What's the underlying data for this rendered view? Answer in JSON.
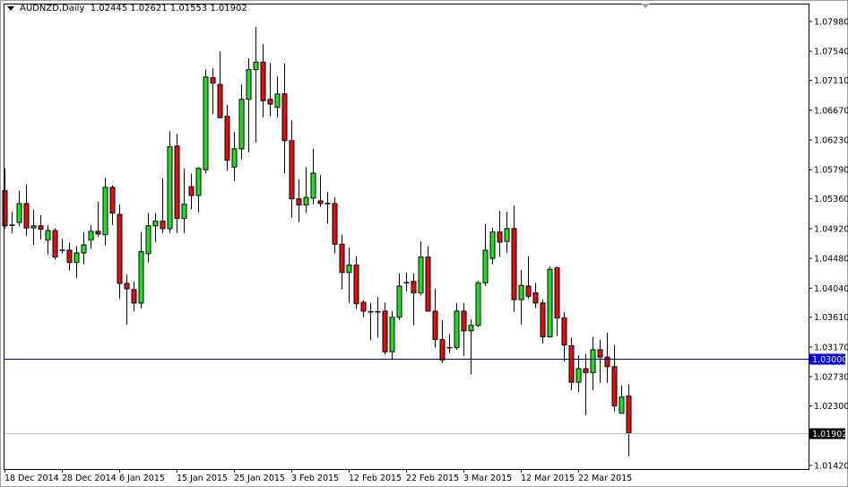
{
  "header": {
    "symbol": "AUDNZD,Daily",
    "ohlc": "1.02445 1.02621 1.01553 1.01902"
  },
  "colors": {
    "bull": "#22dd22",
    "bear": "#dd1111",
    "level_line": "#000080",
    "level_badge": "#0000ee",
    "price_line": "#c0c0c0",
    "price_badge": "#000000"
  },
  "chart_data": {
    "type": "candlestick",
    "title": "AUDNZD,Daily",
    "ylim": [
      1.0134,
      1.0825
    ],
    "y_ticks": [
      "1.07980",
      "1.07540",
      "1.07110",
      "1.06670",
      "1.06230",
      "1.05790",
      "1.05360",
      "1.04920",
      "1.04480",
      "1.04040",
      "1.03610",
      "1.03170",
      "1.02730",
      "1.02300",
      "1.01420"
    ],
    "x_labels": [
      {
        "index": 0,
        "label": "18 Dec 2014"
      },
      {
        "index": 8,
        "label": "28 Dec 2014"
      },
      {
        "index": 16,
        "label": "6 Jan 2015"
      },
      {
        "index": 24,
        "label": "15 Jan 2015"
      },
      {
        "index": 32,
        "label": "25 Jan 2015"
      },
      {
        "index": 40,
        "label": "3 Feb 2015"
      },
      {
        "index": 48,
        "label": "12 Feb 2015"
      },
      {
        "index": 56,
        "label": "22 Feb 2015"
      },
      {
        "index": 64,
        "label": "3 Mar 2015"
      },
      {
        "index": 72,
        "label": "12 Mar 2015"
      },
      {
        "index": 80,
        "label": "22 Mar 2015"
      }
    ],
    "horizontal_level": {
      "value": 1.03,
      "label": "1.03000"
    },
    "current_price": {
      "value": 1.01902,
      "label": "1.01902"
    },
    "candles": [
      [
        1.0548,
        1.0581,
        1.0492,
        1.0496
      ],
      [
        1.0497,
        1.0517,
        1.0485,
        1.0496
      ],
      [
        1.0501,
        1.0548,
        1.0495,
        1.0529
      ],
      [
        1.0529,
        1.0557,
        1.0481,
        1.0493
      ],
      [
        1.0493,
        1.052,
        1.0468,
        1.0496
      ],
      [
        1.0496,
        1.0512,
        1.0476,
        1.0491
      ],
      [
        1.0475,
        1.0497,
        1.0454,
        1.0489
      ],
      [
        1.0489,
        1.0492,
        1.0446,
        1.045
      ],
      [
        1.046,
        1.0477,
        1.0455,
        1.0459
      ],
      [
        1.046,
        1.0471,
        1.043,
        1.0442
      ],
      [
        1.0442,
        1.0466,
        1.0419,
        1.0456
      ],
      [
        1.0456,
        1.0487,
        1.0439,
        1.0468
      ],
      [
        1.0475,
        1.0497,
        1.0462,
        1.0488
      ],
      [
        1.0488,
        1.0532,
        1.048,
        1.0484
      ],
      [
        1.0483,
        1.0567,
        1.0467,
        1.0553
      ],
      [
        1.0553,
        1.0556,
        1.0497,
        1.0515
      ],
      [
        1.0513,
        1.0528,
        1.0388,
        1.0411
      ],
      [
        1.0411,
        1.0424,
        1.035,
        1.0403
      ],
      [
        1.0402,
        1.0414,
        1.037,
        1.0382
      ],
      [
        1.0382,
        1.0487,
        1.0374,
        1.0458
      ],
      [
        1.0455,
        1.0515,
        1.0442,
        1.0496
      ],
      [
        1.0496,
        1.0515,
        1.0472,
        1.0503
      ],
      [
        1.0503,
        1.0566,
        1.0485,
        1.0492
      ],
      [
        1.0492,
        1.0636,
        1.0485,
        1.0613
      ],
      [
        1.0614,
        1.0632,
        1.0485,
        1.0507
      ],
      [
        1.0507,
        1.0581,
        1.0485,
        1.0528
      ],
      [
        1.0554,
        1.0573,
        1.0521,
        1.0541
      ],
      [
        1.0541,
        1.0583,
        1.0516,
        1.0581
      ],
      [
        1.0579,
        1.0727,
        1.0574,
        1.0716
      ],
      [
        1.0715,
        1.0729,
        1.0661,
        1.0707
      ],
      [
        1.0705,
        1.0754,
        1.0655,
        1.0656
      ],
      [
        1.0658,
        1.0675,
        1.0577,
        1.0593
      ],
      [
        1.0583,
        1.0635,
        1.0562,
        1.061
      ],
      [
        1.061,
        1.0705,
        1.0595,
        1.0683
      ],
      [
        1.0683,
        1.0744,
        1.0605,
        1.0727
      ],
      [
        1.0727,
        1.079,
        1.0619,
        1.0738
      ],
      [
        1.0738,
        1.0765,
        1.0656,
        1.0681
      ],
      [
        1.0683,
        1.0737,
        1.0658,
        1.0676
      ],
      [
        1.0671,
        1.0717,
        1.0656,
        1.0691
      ],
      [
        1.0691,
        1.0736,
        1.0574,
        1.0622
      ],
      [
        1.0622,
        1.0652,
        1.0508,
        1.0536
      ],
      [
        1.0536,
        1.0565,
        1.0501,
        1.0527
      ],
      [
        1.0527,
        1.0583,
        1.0515,
        1.0538
      ],
      [
        1.0537,
        1.061,
        1.0528,
        1.0574
      ],
      [
        1.0533,
        1.0571,
        1.0524,
        1.0529
      ],
      [
        1.0529,
        1.0546,
        1.05,
        1.0529
      ],
      [
        1.0529,
        1.0538,
        1.0455,
        1.0469
      ],
      [
        1.0469,
        1.0483,
        1.0402,
        1.0427
      ],
      [
        1.0427,
        1.0464,
        1.0382,
        1.0438
      ],
      [
        1.0438,
        1.0451,
        1.0373,
        1.0381
      ],
      [
        1.0383,
        1.0386,
        1.0361,
        1.037
      ],
      [
        1.0369,
        1.0382,
        1.0327,
        1.0369
      ],
      [
        1.0369,
        1.0391,
        1.0331,
        1.0368
      ],
      [
        1.037,
        1.0383,
        1.0306,
        1.031
      ],
      [
        1.031,
        1.037,
        1.0298,
        1.0361
      ],
      [
        1.0361,
        1.0426,
        1.0357,
        1.0407
      ],
      [
        1.0412,
        1.0427,
        1.0399,
        1.0412
      ],
      [
        1.0414,
        1.0426,
        1.0349,
        1.0397
      ],
      [
        1.0397,
        1.0473,
        1.0394,
        1.045
      ],
      [
        1.045,
        1.0466,
        1.037,
        1.037
      ],
      [
        1.037,
        1.0403,
        1.0316,
        1.0328
      ],
      [
        1.0328,
        1.0357,
        1.0293,
        1.0298
      ],
      [
        1.0316,
        1.0336,
        1.0308,
        1.0316
      ],
      [
        1.0316,
        1.0382,
        1.0313,
        1.037
      ],
      [
        1.037,
        1.0382,
        1.0304,
        1.0341
      ],
      [
        1.0341,
        1.0358,
        1.0277,
        1.0349
      ],
      [
        1.0349,
        1.0415,
        1.0346,
        1.0412
      ],
      [
        1.0412,
        1.0499,
        1.0407,
        1.046
      ],
      [
        1.0448,
        1.0493,
        1.0439,
        1.0487
      ],
      [
        1.0487,
        1.0518,
        1.045,
        1.0472
      ],
      [
        1.0473,
        1.0517,
        1.0456,
        1.0492
      ],
      [
        1.0492,
        1.0526,
        1.0369,
        1.0387
      ],
      [
        1.0387,
        1.0431,
        1.035,
        1.0408
      ],
      [
        1.0407,
        1.0451,
        1.0388,
        1.0392
      ],
      [
        1.0397,
        1.0412,
        1.0375,
        1.0382
      ],
      [
        1.0382,
        1.0387,
        1.0322,
        1.0332
      ],
      [
        1.0332,
        1.0436,
        1.0331,
        1.0432
      ],
      [
        1.0434,
        1.0436,
        1.0333,
        1.036
      ],
      [
        1.036,
        1.0369,
        1.0296,
        1.032
      ],
      [
        1.0319,
        1.0331,
        1.0253,
        1.0265
      ],
      [
        1.0265,
        1.0305,
        1.025,
        1.0285
      ],
      [
        1.0285,
        1.0307,
        1.0216,
        1.0279
      ],
      [
        1.0279,
        1.0332,
        1.0253,
        1.0313
      ],
      [
        1.0313,
        1.0328,
        1.0264,
        1.0302
      ],
      [
        1.0302,
        1.0338,
        1.0264,
        1.0288
      ],
      [
        1.0288,
        1.032,
        1.0222,
        1.023
      ],
      [
        1.0219,
        1.026,
        1.0219,
        1.0243
      ],
      [
        1.02445,
        1.02621,
        1.01553,
        1.01902
      ]
    ]
  }
}
